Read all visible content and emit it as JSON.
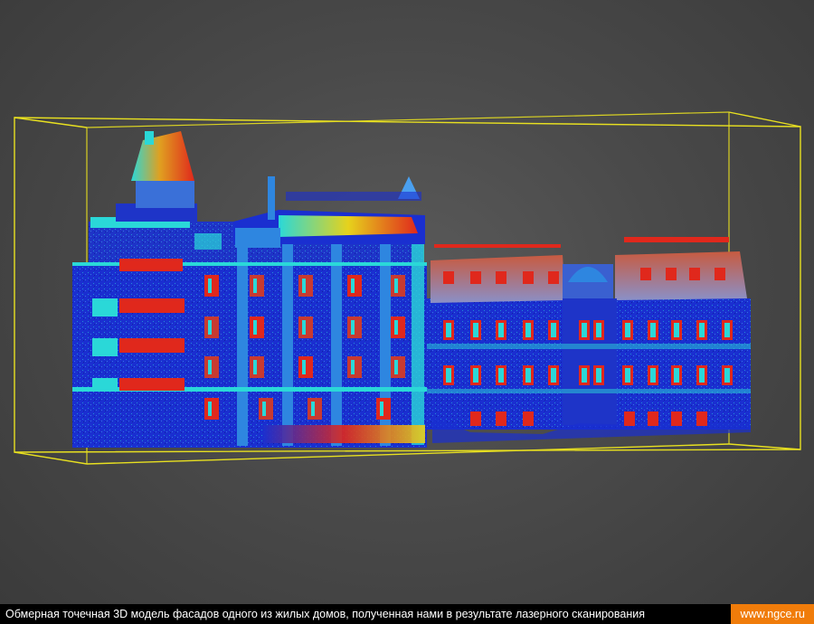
{
  "caption": {
    "text": "Обмерная точечная 3D модель фасадов одного из жилых домов, полученная нами в результате лазерного сканирования",
    "site": "www.ngce.ru"
  },
  "colors": {
    "bounding_box": "#e8e020",
    "facade_blue": "#1a2fd0",
    "facade_light_blue": "#2e86e0",
    "cyan": "#2ad8d8",
    "yellow": "#e6d21c",
    "red": "#e0281c",
    "caption_bg": "#000000",
    "site_bg": "#f07c0a"
  }
}
